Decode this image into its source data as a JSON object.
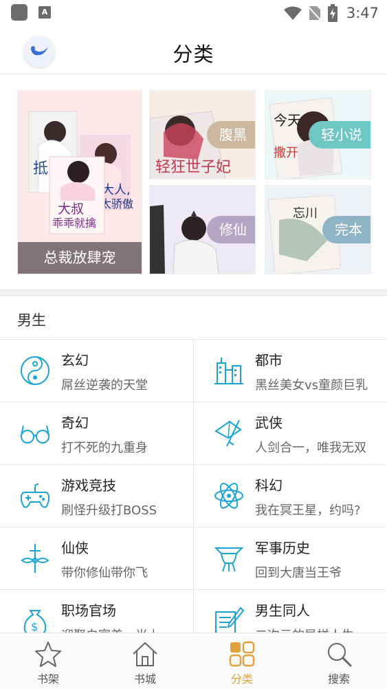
{
  "status_bar": {
    "time": "3:47"
  },
  "header": {
    "title": "分类"
  },
  "banners": {
    "big": {
      "label": "总裁放肆宠"
    },
    "small": [
      {
        "label": "腹黑",
        "color": "#cbb89e"
      },
      {
        "label": "轻小说",
        "color": "#6fc7c4"
      },
      {
        "label": "修仙",
        "color": "#b2a6c4"
      },
      {
        "label": "完本",
        "color": "#8fb4c6"
      }
    ]
  },
  "section": {
    "title": "男生"
  },
  "categories": [
    {
      "name": "玄幻",
      "desc": "屌丝逆袭的天堂",
      "icon": "yin-yang-icon"
    },
    {
      "name": "都市",
      "desc": "黑丝美女vs童颜巨乳",
      "icon": "city-buildings-icon"
    },
    {
      "name": "奇幻",
      "desc": "打不死的九重身",
      "icon": "glasses-icon"
    },
    {
      "name": "武侠",
      "desc": "人剑合一，唯我无双",
      "icon": "hat-sword-icon"
    },
    {
      "name": "游戏竞技",
      "desc": "刷怪升级打BOSS",
      "icon": "gamepad-icon"
    },
    {
      "name": "科幻",
      "desc": "我在冥王星，约吗?",
      "icon": "atom-icon"
    },
    {
      "name": "仙侠",
      "desc": "带你修仙带你飞",
      "icon": "flying-sword-icon"
    },
    {
      "name": "军事历史",
      "desc": "回到大唐当王爷",
      "icon": "ancient-vessel-icon"
    },
    {
      "name": "职场官场",
      "desc": "迎娶白富美，当上",
      "icon": "money-bag-icon"
    },
    {
      "name": "男生同人",
      "desc": "二次元的异样人生",
      "icon": "pen-paper-icon"
    }
  ],
  "bottom_nav": [
    {
      "label": "书架",
      "icon": "star-icon",
      "active": false
    },
    {
      "label": "书城",
      "icon": "house-icon",
      "active": false
    },
    {
      "label": "分类",
      "icon": "grid-icon",
      "active": true
    },
    {
      "label": "搜索",
      "icon": "search-icon",
      "active": false
    }
  ],
  "colors": {
    "accent": "#1aa3d6",
    "active_nav": "#e0a23c"
  }
}
